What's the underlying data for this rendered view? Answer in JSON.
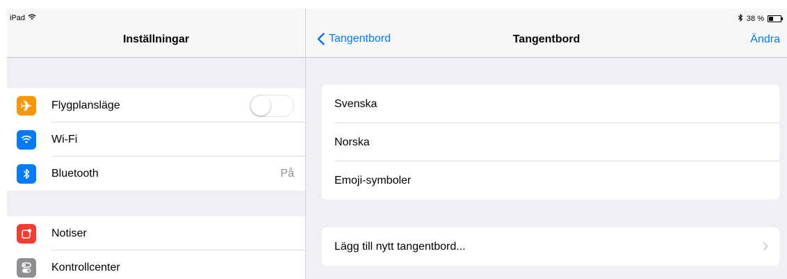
{
  "status": {
    "device": "iPad",
    "battery": "38 %",
    "battery_level": 0.38
  },
  "left": {
    "title": "Inställningar",
    "group1": [
      {
        "label": "Flygplansläge",
        "icon": "airplane-icon",
        "color": "#ff9500",
        "toggle": false
      },
      {
        "label": "Wi-Fi",
        "icon": "wifi-icon",
        "color": "#007aff"
      },
      {
        "label": "Bluetooth",
        "icon": "bluetooth-icon",
        "color": "#007aff",
        "value": "På"
      }
    ],
    "group2": [
      {
        "label": "Notiser",
        "icon": "notifications-icon",
        "color": "#ff3b30"
      },
      {
        "label": "Kontrollcenter",
        "icon": "control-center-icon",
        "color": "#8e8e93"
      }
    ]
  },
  "right": {
    "back_label": "Tangentbord",
    "title": "Tangentbord",
    "edit_label": "Ändra",
    "keyboards": [
      "Svenska",
      "Norska",
      "Emoji-symboler"
    ],
    "add_keyboard_label": "Lägg till nytt tangentbord..."
  }
}
